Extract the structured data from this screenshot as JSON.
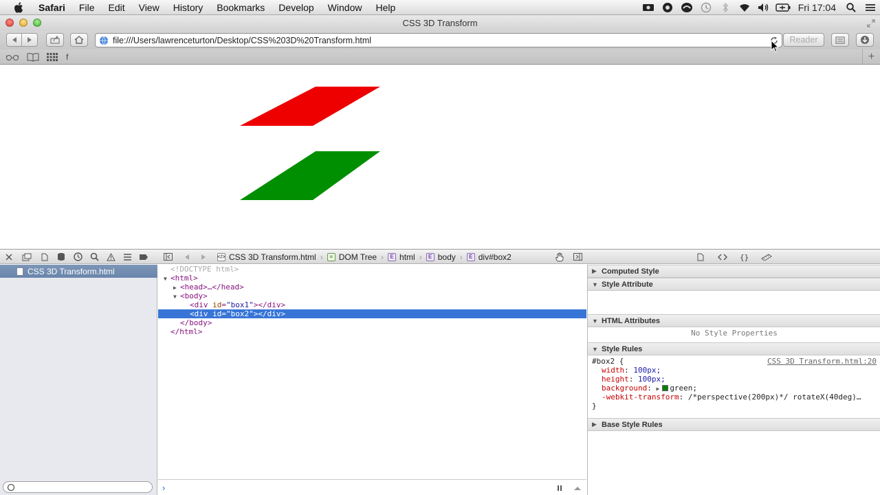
{
  "menubar": {
    "items": [
      "Safari",
      "File",
      "Edit",
      "View",
      "History",
      "Bookmarks",
      "Develop",
      "Window",
      "Help"
    ],
    "clock": "Fri 17:04"
  },
  "window": {
    "title": "CSS 3D Transform"
  },
  "toolbar": {
    "url": "file:///Users/lawrenceturton/Desktop/CSS%203D%20Transform.html",
    "reader_label": "Reader"
  },
  "bookmarks": {
    "items": [
      "f"
    ]
  },
  "page": {
    "box1_color": "#ee0000",
    "box2_color": "#008f00"
  },
  "inspector": {
    "breadcrumbs": [
      "CSS 3D Transform.html",
      "DOM Tree",
      "html",
      "body",
      "div#box2"
    ],
    "sidebar_item": "CSS 3D Transform.html",
    "dom": {
      "doctype": "<!DOCTYPE html>",
      "html_open": "<html>",
      "head": "<head>…</head>",
      "body_open": "<body>",
      "div1_tag": "<div",
      "div1_attr": "id",
      "div1_val": "\"box1\"",
      "div1_close": "></div>",
      "div2_tag": "<div",
      "div2_attr": "id",
      "div2_val": "\"box2\"",
      "div2_close": "></div>",
      "body_close": "</body>",
      "html_close": "</html>"
    },
    "styles": {
      "sections": [
        "Computed Style",
        "Style Attribute",
        "HTML Attributes",
        "Style Rules",
        "Base Style Rules"
      ],
      "no_props": "No Style Properties",
      "selector": "#box2 {",
      "source": "CSS 3D Transform.html:20",
      "props": [
        {
          "name": "width",
          "value": "100px;"
        },
        {
          "name": "height",
          "value": "100px;"
        },
        {
          "name": "background",
          "value": "green;"
        },
        {
          "name": "-webkit-transform",
          "value": "/*perspective(200px)*/ rotateX(40deg)…"
        }
      ],
      "close_brace": "}"
    }
  }
}
